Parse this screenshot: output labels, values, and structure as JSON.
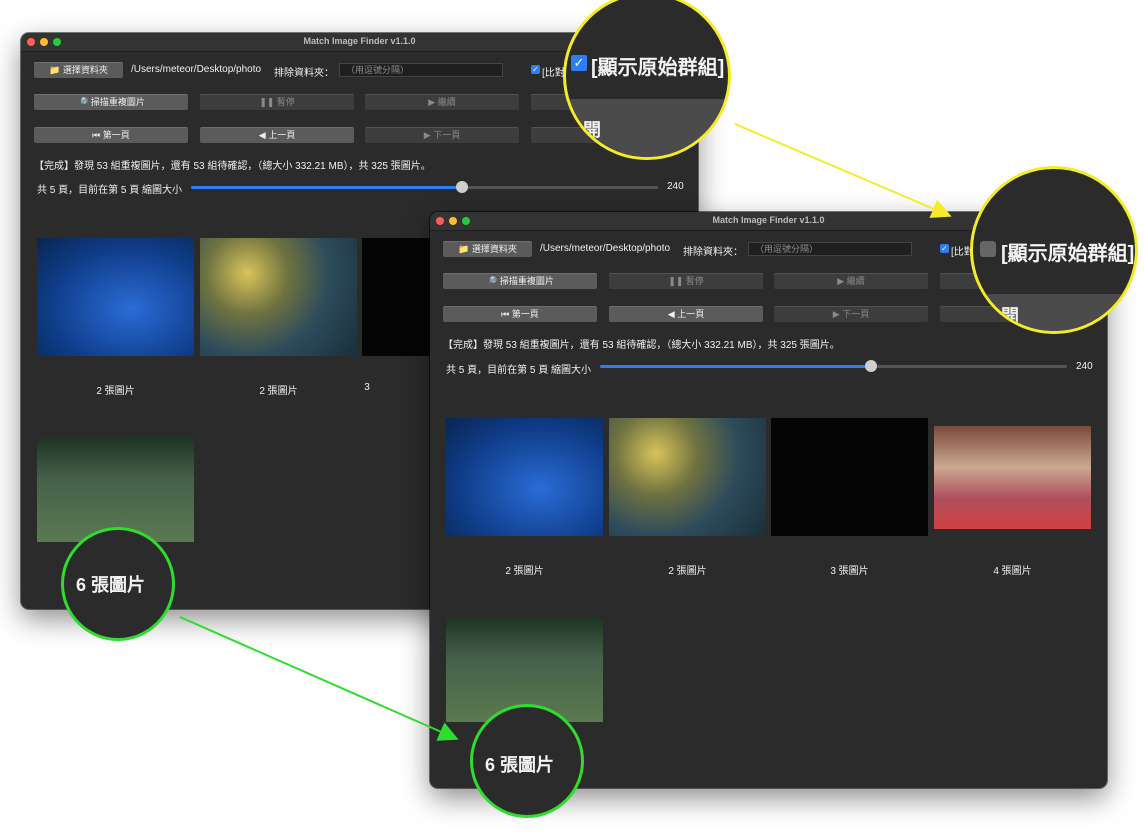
{
  "app": {
    "title": "Match Image Finder v1.1.0",
    "choose_folder_label": "選擇資料夾",
    "folder_path": "/Users/meteor/Desktop/photo",
    "exclude_label": "排除資料夾：",
    "exclude_placeholder": "（用逗號分隔）",
    "compare_checkbox_label": "[比對",
    "compare_checkbox_checked": true,
    "scan_label": "掃描重複圖片",
    "pause_label": "暫停",
    "resume_label": "繼續",
    "first_page_label": "第一頁",
    "prev_page_label": "上一頁",
    "next_page_label": "下一頁",
    "status_text": "【完成】發現 53 組重複圖片，還有 53 組待確認，（總大小 332.21 MB），共 325 張圖片。",
    "page_info": "共 5 頁，目前在第 5 頁 縮圖大小",
    "thumb_size": "240",
    "thumb_size_fraction": 0.58,
    "accent_color": "#2f7df6"
  },
  "back_window": {
    "groups": [
      {
        "caption": "2 張圖片",
        "image": "fish-tank"
      },
      {
        "caption": "2 張圖片",
        "image": "underwater-yellow"
      },
      {
        "caption": "3",
        "image": "dark-sparkle"
      },
      {
        "caption": "6 張圖片",
        "image": "grass-bird"
      }
    ],
    "zoom_checkbox_label": "[顯示原始群組]",
    "zoom_checkbox_checked": true,
    "zoom_button_label": "開",
    "zoom_caption": "6 張圖片"
  },
  "front_window": {
    "groups": [
      {
        "caption": "2 張圖片",
        "image": "fish-tank"
      },
      {
        "caption": "2 張圖片",
        "image": "underwater-yellow"
      },
      {
        "caption": "3 張圖片",
        "image": "dark-sparkle"
      },
      {
        "caption": "4 張圖片",
        "image": "crowd-red-carpet"
      },
      {
        "caption": "6 張圖片",
        "image": "grass-bird"
      }
    ],
    "compare_checkbox_label": "[比對",
    "zoom_checkbox_label": "[顯示原始群組]",
    "zoom_checkbox_checked": false,
    "zoom_button_label": "開",
    "zoom_caption": "6 張圖片"
  },
  "annotations": {
    "yellow_color": "#f4ec2a",
    "green_color": "#2fdc2f"
  }
}
